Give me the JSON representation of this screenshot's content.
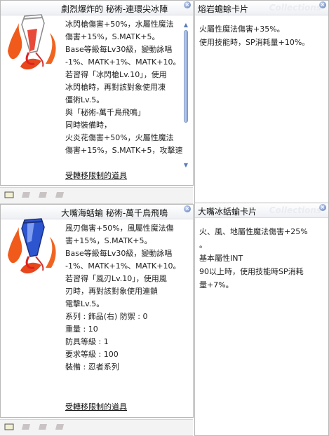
{
  "item1": {
    "title": "劇烈爆炸的 秘術-連環尖冰陣",
    "lines": [
      "冰閃槍傷害+50%，水屬性魔法",
      "傷害+15%，S.MATK+5。",
      "Base等級每Lv30級，變動詠唱",
      "-1%、MATK+1%、MATK+10。",
      "若習得「冰閃槍Lv.10」，使用",
      "冰閃槍時，再對該對象使用凍",
      "僵術Lv.5。",
      "與「秘術-萬千鳥飛鳴」",
      "同時裝備時，",
      "火炎花傷害+50%，火屬性魔法",
      "傷害+15%，S.MATK+5，攻擊速"
    ],
    "restriction": "受轉移限制的道具"
  },
  "card1": {
    "title": "熔岩蟾蜍卡片",
    "watermark": "Collections",
    "lines": [
      "火屬性魔法傷害+35%。",
      "使用技能時，SP消耗量+10%。"
    ]
  },
  "item2": {
    "title": "大嘴海蛞蝓 秘術-萬千鳥飛鳴",
    "lines": [
      "風刃傷害+50%，風屬性魔法傷",
      "害+15%，S.MATK+5。",
      "Base等級每Lv30級，變動詠唱",
      "-1%、MATK+1%、MATK+10。",
      "若習得「風刃Lv.10」，使用風",
      "刃時，再對該對象使用連鎖",
      "電擊Lv.5。"
    ],
    "stats": [
      {
        "label": "系列",
        "value": "飾品(右) 防禦 : 0"
      },
      {
        "label": "重量",
        "value": "10"
      },
      {
        "label": "防具等級",
        "value": "1"
      },
      {
        "label": "要求等級",
        "value": "100"
      },
      {
        "label": "裝備",
        "value": "忍者系列"
      }
    ],
    "restriction": "受轉移限制的道具"
  },
  "card2": {
    "title": "大嘴冰蛞蝓卡片",
    "watermark": "Collections",
    "lines": [
      "火、風、地屬性魔法傷害+25%",
      "。",
      "基本屬性INT",
      "90以上時，使用技能時SP消耗",
      "量+7%。"
    ]
  },
  "close_glyph": "×",
  "scroll": {
    "up": "▲",
    "down": "▼"
  }
}
